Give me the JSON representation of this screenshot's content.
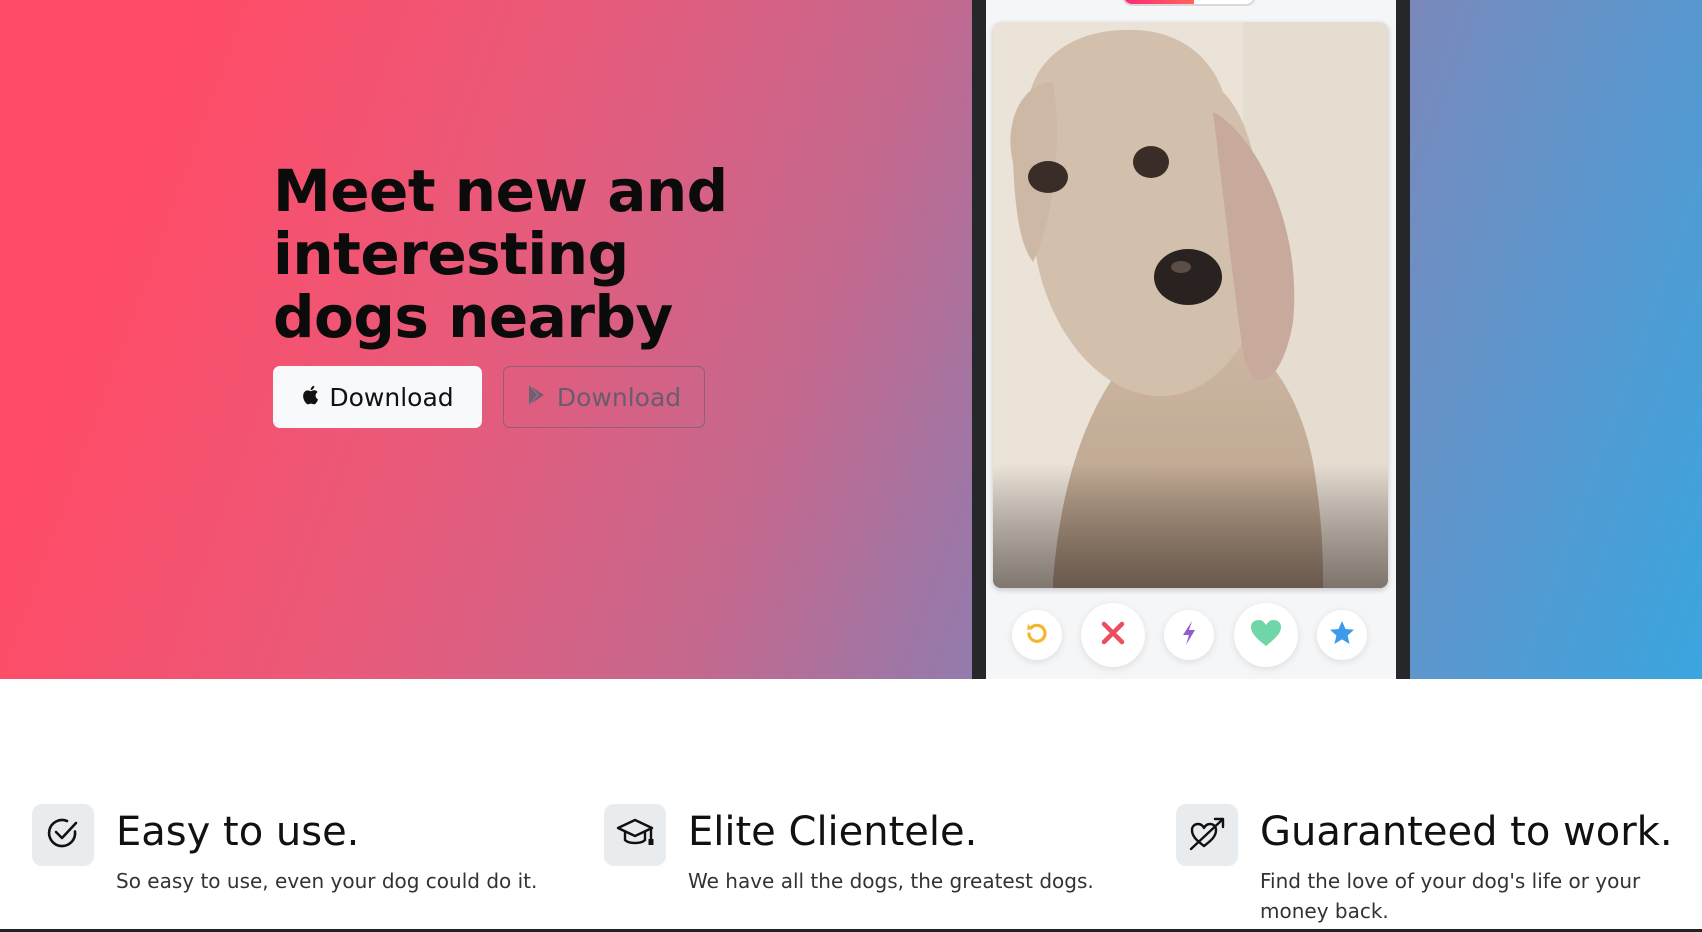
{
  "hero": {
    "title": "Meet new and interesting dogs nearby",
    "apple_button_label": "Download",
    "play_button_label": "Download",
    "apple_icon": "apple-icon",
    "play_icon": "google-play-icon"
  },
  "phone": {
    "photo": "dog-photo",
    "actions": [
      {
        "name": "rewind",
        "icon": "rewind-icon",
        "color": "#f5b52e"
      },
      {
        "name": "nope",
        "icon": "close-icon",
        "color": "#ec5e6f"
      },
      {
        "name": "boost",
        "icon": "lightning-icon",
        "color": "#915dd1"
      },
      {
        "name": "like",
        "icon": "heart-icon",
        "color": "#6fe3b3"
      },
      {
        "name": "super-like",
        "icon": "star-icon",
        "color": "#3ca4ff"
      }
    ]
  },
  "features": [
    {
      "icon": "check-circle-icon",
      "title": "Easy to use.",
      "description": "So easy to use, even your dog could do it."
    },
    {
      "icon": "graduation-cap-icon",
      "title": "Elite Clientele.",
      "description": "We have all the dogs, the greatest dogs."
    },
    {
      "icon": "heart-arrow-icon",
      "title": "Guaranteed to work.",
      "description": "Find the love of your dog's life or your money back."
    }
  ],
  "colors": {
    "hero_gradient_start": "#ff4b66",
    "hero_gradient_end": "#3aa5df",
    "icon_tile": "#e9ecef"
  }
}
